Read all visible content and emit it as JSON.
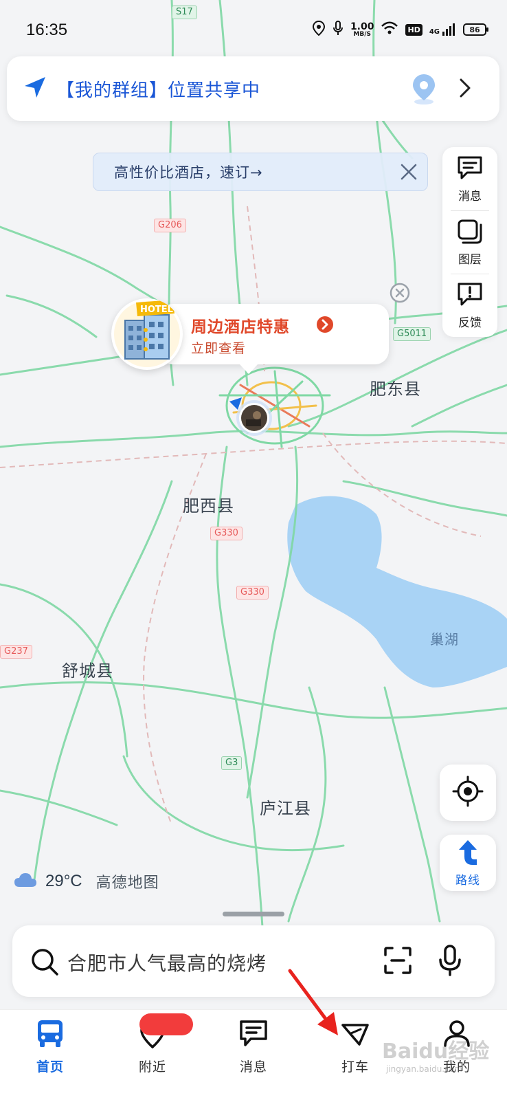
{
  "status_bar": {
    "time": "16:35",
    "speed_value": "1.00",
    "speed_unit": "MB/S",
    "network": "4G",
    "hd": "HD",
    "battery": "86"
  },
  "group_banner": {
    "title": "【我的群组】位置共享中"
  },
  "hotel_tip": {
    "text": "高性价比酒店，速订→"
  },
  "tools": [
    {
      "label": "消息",
      "icon": "message-icon"
    },
    {
      "label": "图层",
      "icon": "layers-icon"
    },
    {
      "label": "反馈",
      "icon": "feedback-icon"
    }
  ],
  "promo": {
    "badge_text": "HOTEL",
    "title": "周边酒店特惠",
    "subtitle": "立即查看"
  },
  "map": {
    "place_labels": [
      "肥东县",
      "肥西县",
      "舒城县",
      "庐江县"
    ],
    "lake_label": "巢湖",
    "road_shields": [
      "S17",
      "G206",
      "G5011",
      "G330",
      "G330",
      "G237",
      "G3"
    ]
  },
  "route_button": {
    "label": "路线"
  },
  "weather": {
    "temperature": "29°C",
    "brand": "高德地图"
  },
  "search": {
    "query": "合肥市人气最高的烧烤"
  },
  "nav": [
    {
      "label": "首页",
      "icon": "bus-icon",
      "active": true
    },
    {
      "label": "附近",
      "icon": "nearby-pin-icon",
      "active": false
    },
    {
      "label": "消息",
      "icon": "message-icon",
      "active": false
    },
    {
      "label": "打车",
      "icon": "taxi-icon",
      "active": false
    },
    {
      "label": "我的",
      "icon": "profile-icon",
      "active": false
    }
  ],
  "watermark": {
    "line1": "Baidu经验",
    "line2": "jingyan.baidu.com"
  },
  "colors": {
    "accent_blue": "#1a6be0",
    "promo_red": "#e0482a",
    "road_green": "#7fd8a4",
    "lake_blue": "#a9d3f5",
    "annotation_red": "#e8231e"
  }
}
